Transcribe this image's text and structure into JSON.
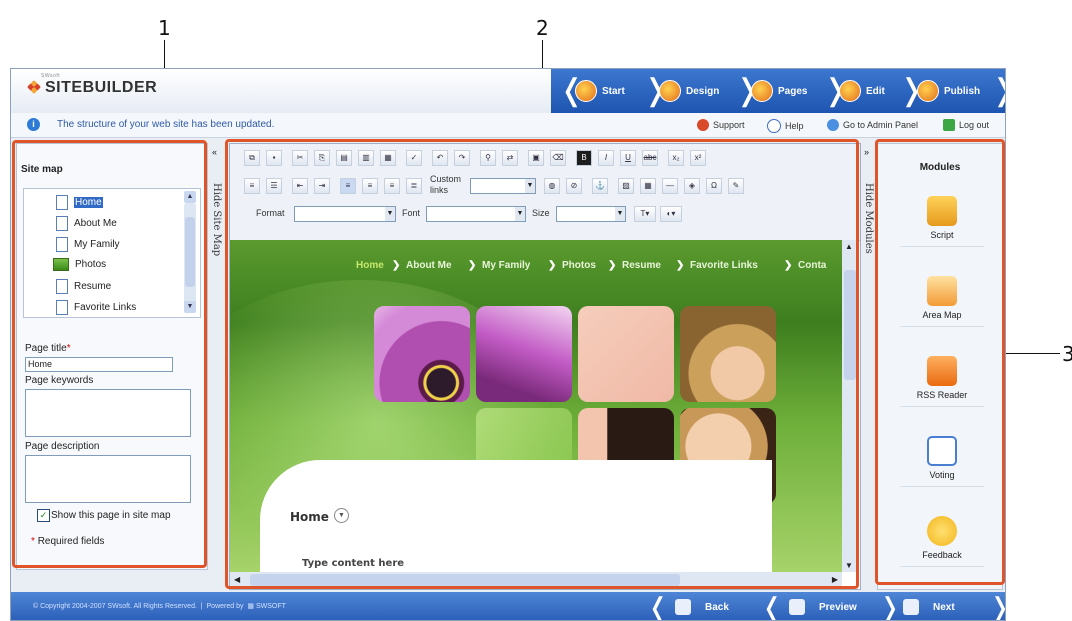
{
  "callouts": [
    "1",
    "2",
    "3"
  ],
  "app": {
    "logo_small": "SWsoft",
    "logo_text": "SITEBUILDER"
  },
  "wizard": {
    "steps": [
      {
        "label": "Start",
        "icon": "start-icon"
      },
      {
        "label": "Design",
        "icon": "design-icon"
      },
      {
        "label": "Pages",
        "icon": "pages-icon"
      },
      {
        "label": "Edit",
        "icon": "edit-icon"
      },
      {
        "label": "Publish",
        "icon": "publish-icon"
      }
    ]
  },
  "infobar": {
    "message": "The structure of your web site has been updated.",
    "links": {
      "support": "Support",
      "help": "Help",
      "admin": "Go to Admin Panel",
      "logout": "Log out"
    }
  },
  "sitemap": {
    "title": "Site map",
    "items": [
      "Home",
      "About Me",
      "My Family",
      "Photos",
      "Resume",
      "Favorite Links"
    ],
    "selected": "Home",
    "page_title_label": "Page title",
    "page_title_value": "Home",
    "keywords_label": "Page keywords",
    "description_label": "Page description",
    "show_in_sitemap_label": "Show this page in site map",
    "show_in_sitemap_checked": true,
    "required_label": "Required fields"
  },
  "strips": {
    "hide_site_map": "Hide Site Map",
    "hide_modules": "Hide Modules"
  },
  "toolbar": {
    "custom_links_label": "Custom links",
    "format_label": "Format",
    "font_label": "Font",
    "size_label": "Size"
  },
  "site": {
    "nav": [
      "Home",
      "About Me",
      "My Family",
      "Photos",
      "Resume",
      "Favorite Links",
      "Conta"
    ],
    "active_nav": "Home",
    "page_heading": "Home",
    "content_placeholder": "Type content here"
  },
  "modules": {
    "title": "Modules",
    "items": [
      {
        "label": "Script",
        "icon": "script-icon",
        "color": "#f4b43a"
      },
      {
        "label": "Area Map",
        "icon": "area-map-icon",
        "color": "#f29a36"
      },
      {
        "label": "RSS Reader",
        "icon": "rss-icon",
        "color": "#f07a1e"
      },
      {
        "label": "Voting",
        "icon": "voting-icon",
        "color": "#4a7ed1"
      },
      {
        "label": "Feedback",
        "icon": "feedback-icon",
        "color": "#f2b51c"
      }
    ]
  },
  "footer": {
    "copyright": "© Copyright 2004-2007 SWsoft. All Rights Reserved.",
    "powered_by": "Powered by",
    "powered_brand": "SWSOFT",
    "back": "Back",
    "preview": "Preview",
    "next": "Next"
  },
  "colors": {
    "highlight": "#e0542a",
    "wizard_blue": "#2a5eb8",
    "site_green": "#4c8c26"
  }
}
